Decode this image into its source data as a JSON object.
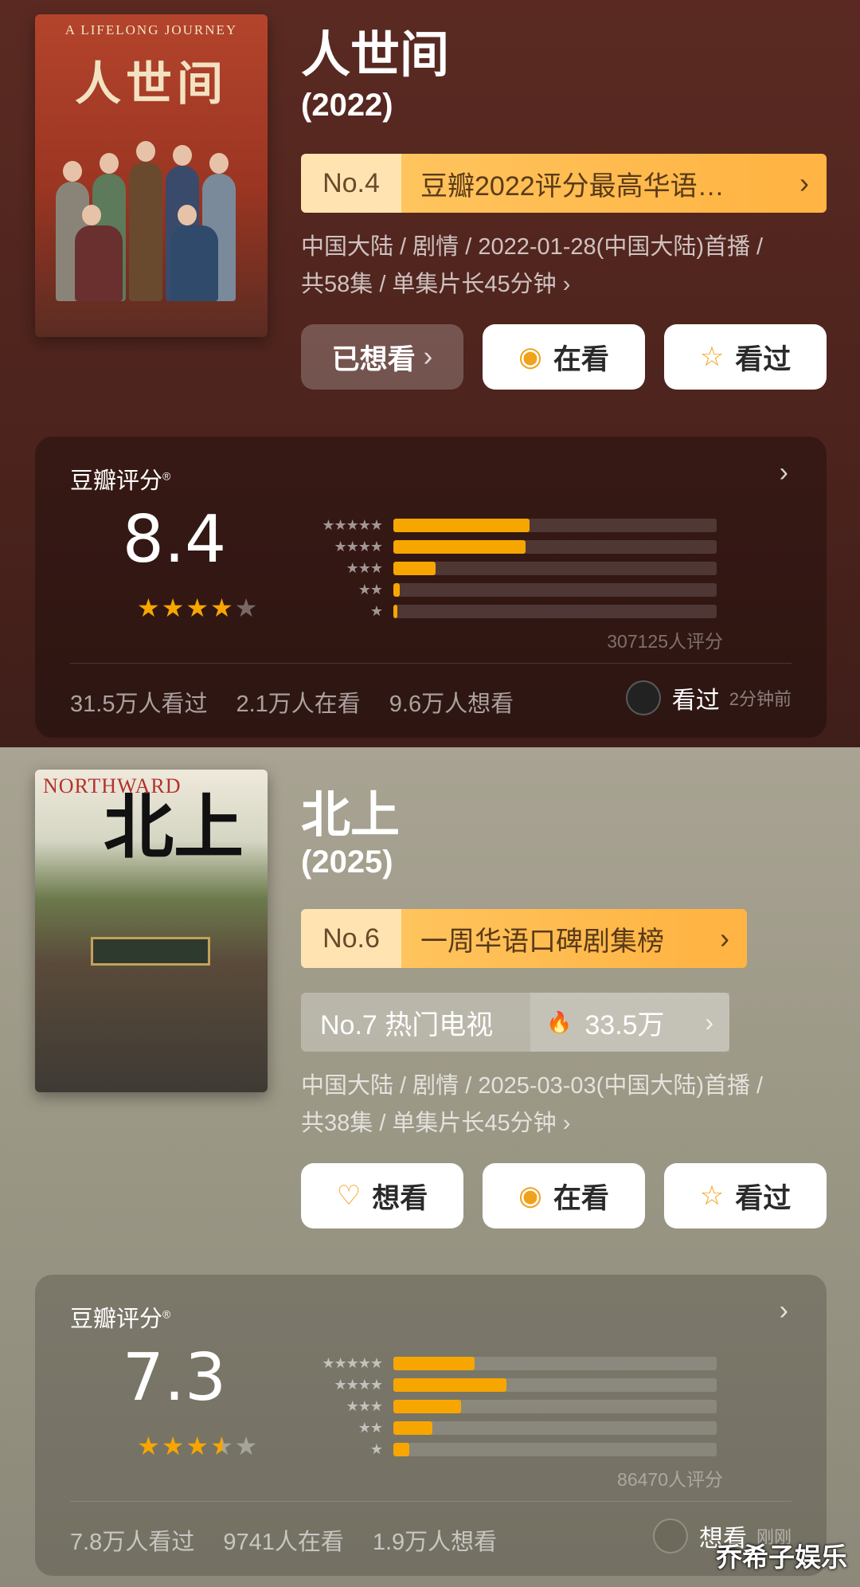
{
  "shows": [
    {
      "title": "人世间",
      "year": "(2022)",
      "poster": {
        "en": "A LIFELONG JOURNEY",
        "cn": "人世间"
      },
      "rank": {
        "no": "No.4",
        "text": "豆瓣2022评分最高华语…",
        "chevron": "›"
      },
      "meta_line1": "中国大陆 / 剧情 / 2022-01-28(中国大陆)首播 /",
      "meta_line2": "共58集 / 单集片长45分钟 ›",
      "buttons": {
        "want": "已想看",
        "watching": "在看",
        "watched": "看过"
      },
      "rating": {
        "label": "豆瓣评分",
        "score": "8.4",
        "stars": 4.0,
        "distribution": [
          0.42,
          0.41,
          0.13,
          0.02,
          0.01
        ],
        "count": "307125人评分",
        "stats": [
          "31.5万人看过",
          "2.1万人在看",
          "9.6万人想看"
        ],
        "activity": {
          "action": "看过",
          "time": "2分钟前"
        }
      }
    },
    {
      "title": "北上",
      "year": "(2025)",
      "poster": {
        "en": "NORTHWARD",
        "cn": "北上"
      },
      "rank": {
        "no": "No.6",
        "text": "一周华语口碑剧集榜",
        "chevron": "›"
      },
      "hot": {
        "label": "No.7 热门电视",
        "value": "33.5万"
      },
      "meta_line1": "中国大陆 / 剧情 / 2025-03-03(中国大陆)首播 /",
      "meta_line2": "共38集 / 单集片长45分钟 ›",
      "buttons": {
        "want": "想看",
        "watching": "在看",
        "watched": "看过"
      },
      "rating": {
        "label": "豆瓣评分",
        "score": "7.3",
        "stars": 3.5,
        "distribution": [
          0.25,
          0.35,
          0.21,
          0.12,
          0.05
        ],
        "count": "86470人评分",
        "stats": [
          "7.8万人看过",
          "9741人在看",
          "1.9万人想看"
        ],
        "activity": {
          "action": "想看",
          "time": "刚刚"
        }
      }
    }
  ],
  "star_labels": [
    "★★★★★",
    "★★★★",
    "★★★",
    "★★",
    "★"
  ],
  "watermark": "乔希子娱乐",
  "colors": {
    "accent": "#f7a600",
    "section1_bg": "#4c231d",
    "section2_bg": "#9a9684"
  },
  "icons": {
    "watching": "target-icon",
    "watched": "star-outline-icon",
    "want": "heart-plus-icon",
    "hot": "flame-icon"
  }
}
